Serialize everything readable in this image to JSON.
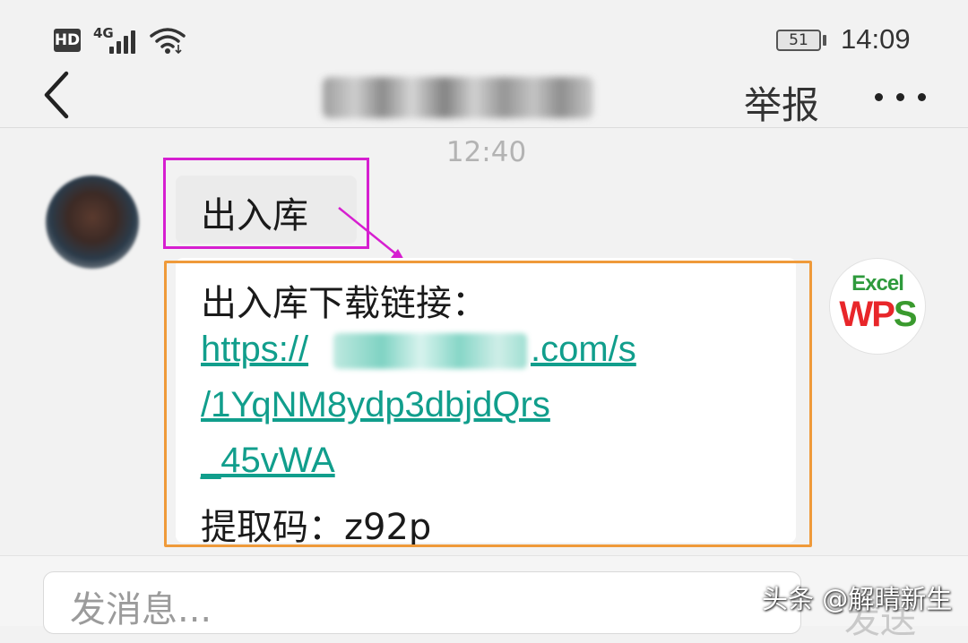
{
  "status_bar": {
    "hd": "HD",
    "network": "4G",
    "battery": "51",
    "time": "14:09"
  },
  "header": {
    "report_label": "举报",
    "more_icon": "more-horizontal-icon",
    "back_icon": "chevron-left-icon"
  },
  "chat": {
    "timestamp": "12:40",
    "message1": "出入库",
    "message2": {
      "line1": "出入库下载链接：",
      "link_prefix": "https://",
      "link_suffix": ".com/s",
      "link_line2": "/1YqNM8ydp3dbjdQrs",
      "link_line3": "_45vWA",
      "code_line": "提取码：z92p"
    },
    "app_icon": {
      "top_text": "Excel",
      "brand_w": "W",
      "brand_p": "P",
      "brand_s": "S"
    }
  },
  "input": {
    "placeholder": "发消息...",
    "send_label": "发送"
  },
  "watermark": "头条 @解晴新生",
  "colors": {
    "highlight_magenta": "#d61fd0",
    "highlight_orange": "#ef9a3a",
    "link": "#119e8c"
  }
}
